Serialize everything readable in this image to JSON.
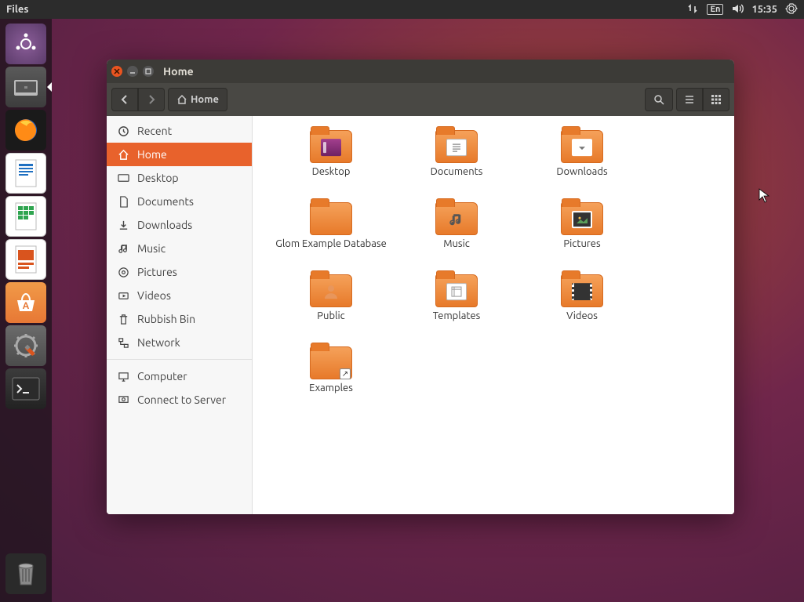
{
  "top_panel": {
    "app_name": "Files",
    "language": "En",
    "time": "15:35"
  },
  "launcher": [
    {
      "name": "dash",
      "label": "Dash"
    },
    {
      "name": "files",
      "label": "Files",
      "active": true
    },
    {
      "name": "firefox",
      "label": "Firefox"
    },
    {
      "name": "writer",
      "label": "LibreOffice Writer"
    },
    {
      "name": "calc",
      "label": "LibreOffice Calc"
    },
    {
      "name": "impress",
      "label": "LibreOffice Impress"
    },
    {
      "name": "software",
      "label": "Ubuntu Software"
    },
    {
      "name": "settings",
      "label": "System Settings"
    },
    {
      "name": "terminal",
      "label": "Terminal"
    }
  ],
  "window": {
    "title": "Home",
    "path_button": "Home"
  },
  "sidebar": {
    "items": [
      {
        "icon": "recent",
        "label": "Recent"
      },
      {
        "icon": "home",
        "label": "Home",
        "selected": true
      },
      {
        "icon": "desktop",
        "label": "Desktop"
      },
      {
        "icon": "documents",
        "label": "Documents"
      },
      {
        "icon": "downloads",
        "label": "Downloads"
      },
      {
        "icon": "music",
        "label": "Music"
      },
      {
        "icon": "pictures",
        "label": "Pictures"
      },
      {
        "icon": "videos",
        "label": "Videos"
      },
      {
        "icon": "trash",
        "label": "Rubbish Bin"
      },
      {
        "icon": "network",
        "label": "Network"
      }
    ],
    "other": [
      {
        "icon": "computer",
        "label": "Computer"
      },
      {
        "icon": "connect",
        "label": "Connect to Server"
      }
    ]
  },
  "files": [
    {
      "name": "Desktop",
      "overlay": "desktop"
    },
    {
      "name": "Documents",
      "overlay": "doc"
    },
    {
      "name": "Downloads",
      "overlay": "down"
    },
    {
      "name": "Glom Example Database",
      "overlay": ""
    },
    {
      "name": "Music",
      "overlay": "music"
    },
    {
      "name": "Pictures",
      "overlay": "pic"
    },
    {
      "name": "Public",
      "overlay": "pub"
    },
    {
      "name": "Templates",
      "overlay": "tpl"
    },
    {
      "name": "Videos",
      "overlay": "vid"
    },
    {
      "name": "Examples",
      "overlay": "",
      "link": true
    }
  ]
}
